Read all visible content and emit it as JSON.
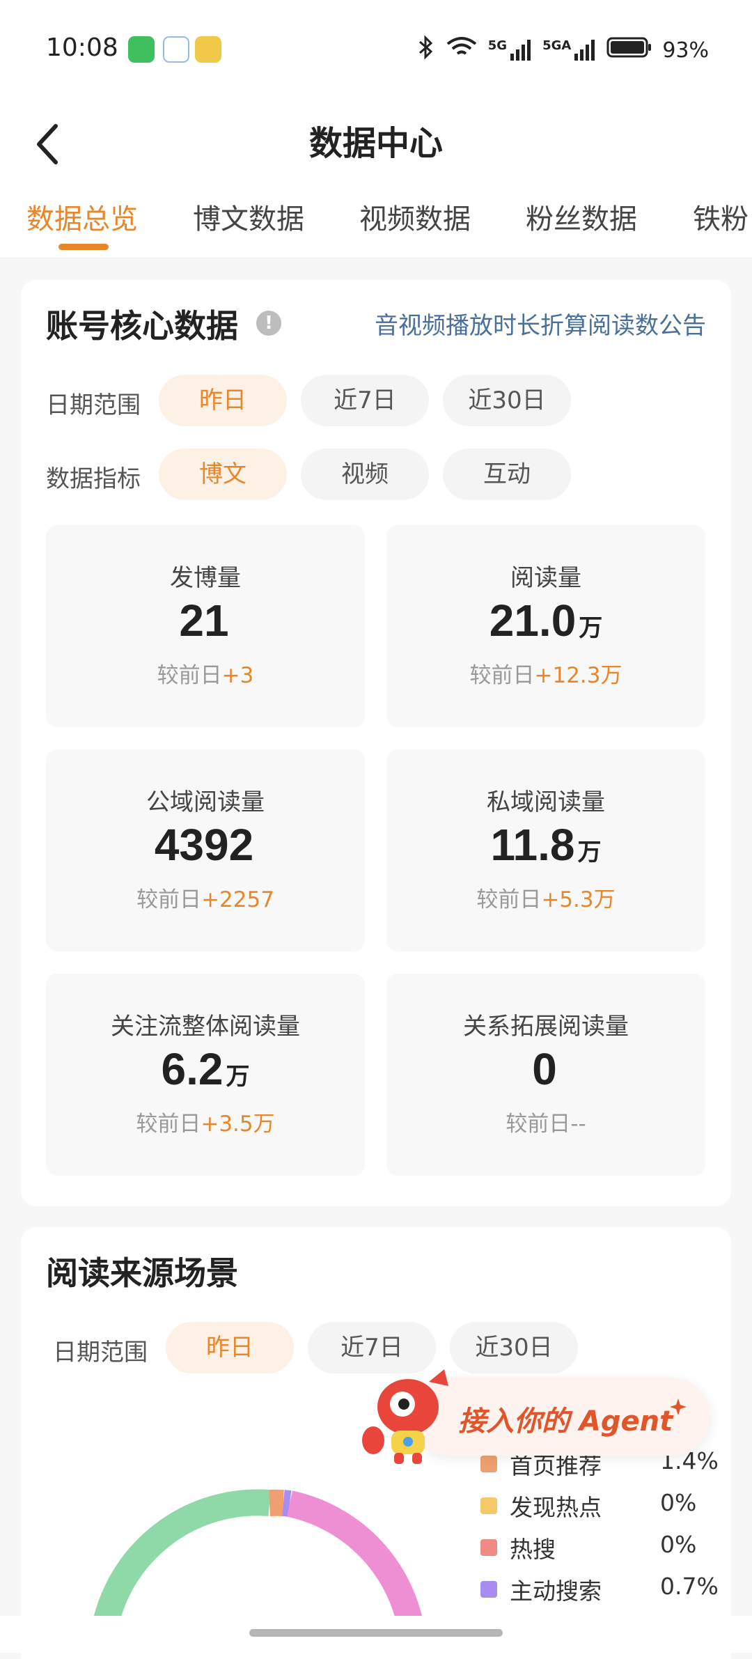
{
  "status_bar": {
    "time": "10:08",
    "battery": "93%",
    "signal_1": "5G",
    "signal_2": "5GA"
  },
  "nav": {
    "title": "数据中心",
    "back_icon": "chevron-left-icon"
  },
  "tabs": [
    {
      "label": "数据总览",
      "active": true
    },
    {
      "label": "博文数据"
    },
    {
      "label": "视频数据"
    },
    {
      "label": "粉丝数据"
    },
    {
      "label": "铁粉"
    }
  ],
  "core": {
    "title": "账号核心数据",
    "notice_link": "音视频播放时长折算阅读数公告",
    "date_range_label": "日期范围",
    "date_options": [
      "昨日",
      "近7日",
      "近30日"
    ],
    "metric_label": "数据指标",
    "metric_options": [
      "博文",
      "视频",
      "互动"
    ],
    "compare_prefix": "较前日",
    "metrics": [
      {
        "label": "发博量",
        "value": "21",
        "unit": "",
        "delta": "+3"
      },
      {
        "label": "阅读量",
        "value": "21.0",
        "unit": "万",
        "delta": "+12.3万"
      },
      {
        "label": "公域阅读量",
        "value": "4392",
        "unit": "",
        "delta": "+2257"
      },
      {
        "label": "私域阅读量",
        "value": "11.8",
        "unit": "万",
        "delta": "+5.3万"
      },
      {
        "label": "关注流整体阅读量",
        "value": "6.2",
        "unit": "万",
        "delta": "+3.5万"
      },
      {
        "label": "关系拓展阅读量",
        "value": "0",
        "unit": "",
        "delta": "--"
      }
    ]
  },
  "source": {
    "title": "阅读来源场景",
    "date_range_label": "日期范围",
    "date_options": [
      "昨日",
      "近7日",
      "近30日"
    ],
    "legend": [
      {
        "label": "首页推荐",
        "pct": "1.4%",
        "color": "#f0a070"
      },
      {
        "label": "发现热点",
        "pct": "0%",
        "color": "#f5c96a"
      },
      {
        "label": "热搜",
        "pct": "0%",
        "color": "#ef8a84"
      },
      {
        "label": "主动搜索",
        "pct": "0.7%",
        "color": "#a98cf0"
      }
    ]
  },
  "agent": {
    "text": "接入你的 Agent"
  },
  "colors": {
    "accent": "#e8872a",
    "link": "#4a6f9a",
    "green_arc": "#8fd9a8",
    "pink_arc": "#ee8fd3"
  }
}
